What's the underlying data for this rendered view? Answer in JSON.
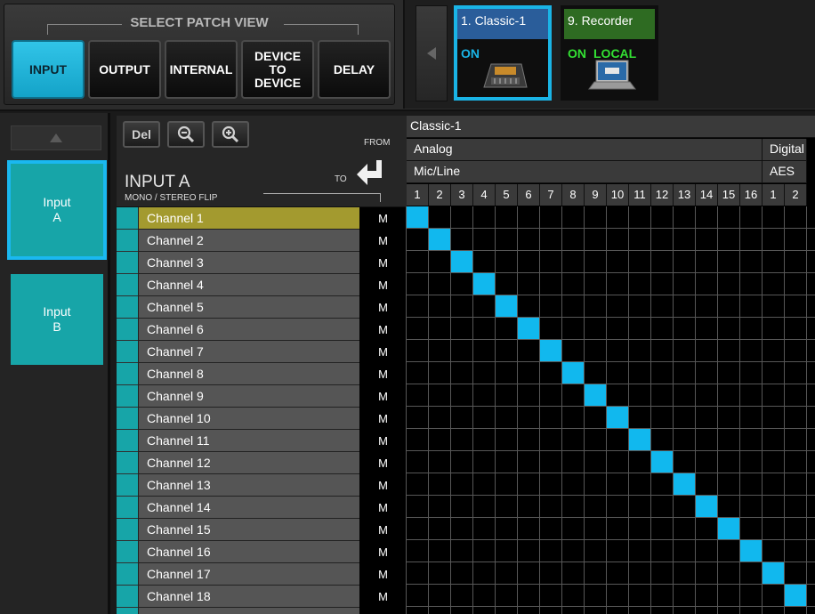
{
  "select_patch_view": {
    "title": "SELECT PATCH VIEW",
    "buttons": [
      {
        "id": "input",
        "label": "INPUT",
        "active": true
      },
      {
        "id": "output",
        "label": "OUTPUT",
        "active": false
      },
      {
        "id": "internal",
        "label": "INTERNAL",
        "active": false
      },
      {
        "id": "device-to-device",
        "label": "DEVICE\nTO\nDEVICE",
        "active": false
      },
      {
        "id": "delay",
        "label": "DELAY",
        "active": false
      }
    ]
  },
  "devices": [
    {
      "name": "1. Classic-1",
      "status": "ON",
      "status_extra": "",
      "selected": true,
      "header_color": "#2a5d9a",
      "status_color": "#1ab4e6",
      "icon": "mixing-console-icon"
    },
    {
      "name": "9. Recorder",
      "status": "ON",
      "status_extra": "LOCAL",
      "selected": false,
      "header_color": "#2e6b22",
      "status_color": "#33e033",
      "icon": "laptop-icon"
    }
  ],
  "input_groups": [
    {
      "label": "Input\nA",
      "selected": true
    },
    {
      "label": "Input\nB",
      "selected": false
    }
  ],
  "toolbar": {
    "del_label": "Del",
    "zoom_out_icon": "zoom-out-icon",
    "zoom_in_icon": "zoom-in-icon",
    "from_label": "FROM",
    "to_label": "TO",
    "title": "INPUT A",
    "subtitle": "MONO / STEREO FLIP"
  },
  "channels": [
    {
      "name": "Channel 1",
      "mode": "M"
    },
    {
      "name": "Channel 2",
      "mode": "M"
    },
    {
      "name": "Channel 3",
      "mode": "M"
    },
    {
      "name": "Channel 4",
      "mode": "M"
    },
    {
      "name": "Channel 5",
      "mode": "M"
    },
    {
      "name": "Channel 6",
      "mode": "M"
    },
    {
      "name": "Channel 7",
      "mode": "M"
    },
    {
      "name": "Channel 8",
      "mode": "M"
    },
    {
      "name": "Channel 9",
      "mode": "M"
    },
    {
      "name": "Channel 10",
      "mode": "M"
    },
    {
      "name": "Channel 11",
      "mode": "M"
    },
    {
      "name": "Channel 12",
      "mode": "M"
    },
    {
      "name": "Channel 13",
      "mode": "M"
    },
    {
      "name": "Channel 14",
      "mode": "M"
    },
    {
      "name": "Channel 15",
      "mode": "M"
    },
    {
      "name": "Channel 16",
      "mode": "M"
    },
    {
      "name": "Channel 17",
      "mode": "M"
    },
    {
      "name": "Channel 18",
      "mode": "M"
    }
  ],
  "active_channel": 0,
  "matrix": {
    "device_label": "Classic-1",
    "groups": [
      {
        "label": "Analog",
        "sub": "Mic/Line",
        "ports": [
          "1",
          "2",
          "3",
          "4",
          "5",
          "6",
          "7",
          "8",
          "9",
          "10",
          "11",
          "12",
          "13",
          "14",
          "15",
          "16"
        ]
      },
      {
        "label": "Digital",
        "sub": "AES",
        "ports": [
          "1",
          "2"
        ]
      }
    ],
    "patches": [
      [
        0,
        0
      ],
      [
        1,
        1
      ],
      [
        2,
        2
      ],
      [
        3,
        3
      ],
      [
        4,
        4
      ],
      [
        5,
        5
      ],
      [
        6,
        6
      ],
      [
        7,
        7
      ],
      [
        8,
        8
      ],
      [
        9,
        9
      ],
      [
        10,
        10
      ],
      [
        11,
        11
      ],
      [
        12,
        12
      ],
      [
        13,
        13
      ],
      [
        14,
        14
      ],
      [
        15,
        15
      ],
      [
        16,
        16
      ],
      [
        17,
        17
      ]
    ],
    "patch_color": "#11b8ee"
  }
}
